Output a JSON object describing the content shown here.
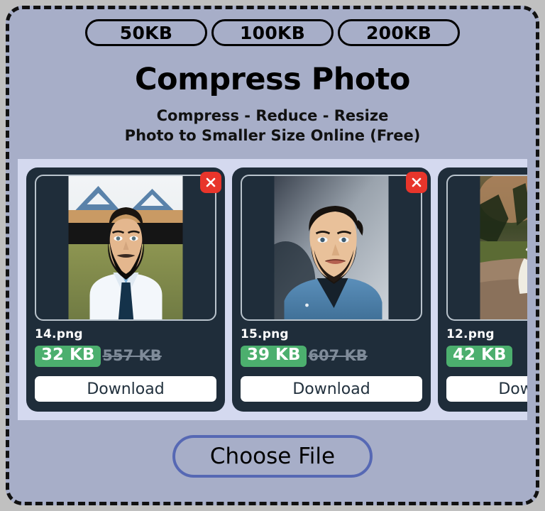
{
  "theme": {
    "page_bg": "#a7aec8",
    "outer_bg": "#c0c0c0",
    "carousel_bg": "#d4d9ef",
    "card_bg": "#1f2d3a",
    "badge_green": "#4caf6e",
    "close_red": "#e8352b",
    "choose_border": "#5668b4",
    "old_size_gray": "#7f8b99"
  },
  "presets": [
    {
      "label": "50KB",
      "name": "preset-50kb"
    },
    {
      "label": "100KB",
      "name": "preset-100kb"
    },
    {
      "label": "200KB",
      "name": "preset-200kb"
    }
  ],
  "header": {
    "title": "Compress Photo",
    "subtitle_line1": "Compress - Reduce - Resize",
    "subtitle_line2": "Photo to Smaller Size Online (Free)"
  },
  "cards": [
    {
      "filename": "14.png",
      "new_size": "32 KB",
      "old_size": "557 KB",
      "download_label": "Download",
      "close_icon": "close-icon",
      "photo": "bearded-man-white-shirt-tie"
    },
    {
      "filename": "15.png",
      "new_size": "39 KB",
      "old_size": "607 KB",
      "download_label": "Download",
      "close_icon": "close-icon",
      "photo": "smiling-man-denim-shirt"
    },
    {
      "filename": "12.png",
      "new_size": "42 KB",
      "old_size": "",
      "download_label": "Download",
      "close_icon": "close-icon",
      "photo": "person-white-dress-outdoor-path"
    }
  ],
  "footer": {
    "choose_file_label": "Choose File"
  }
}
